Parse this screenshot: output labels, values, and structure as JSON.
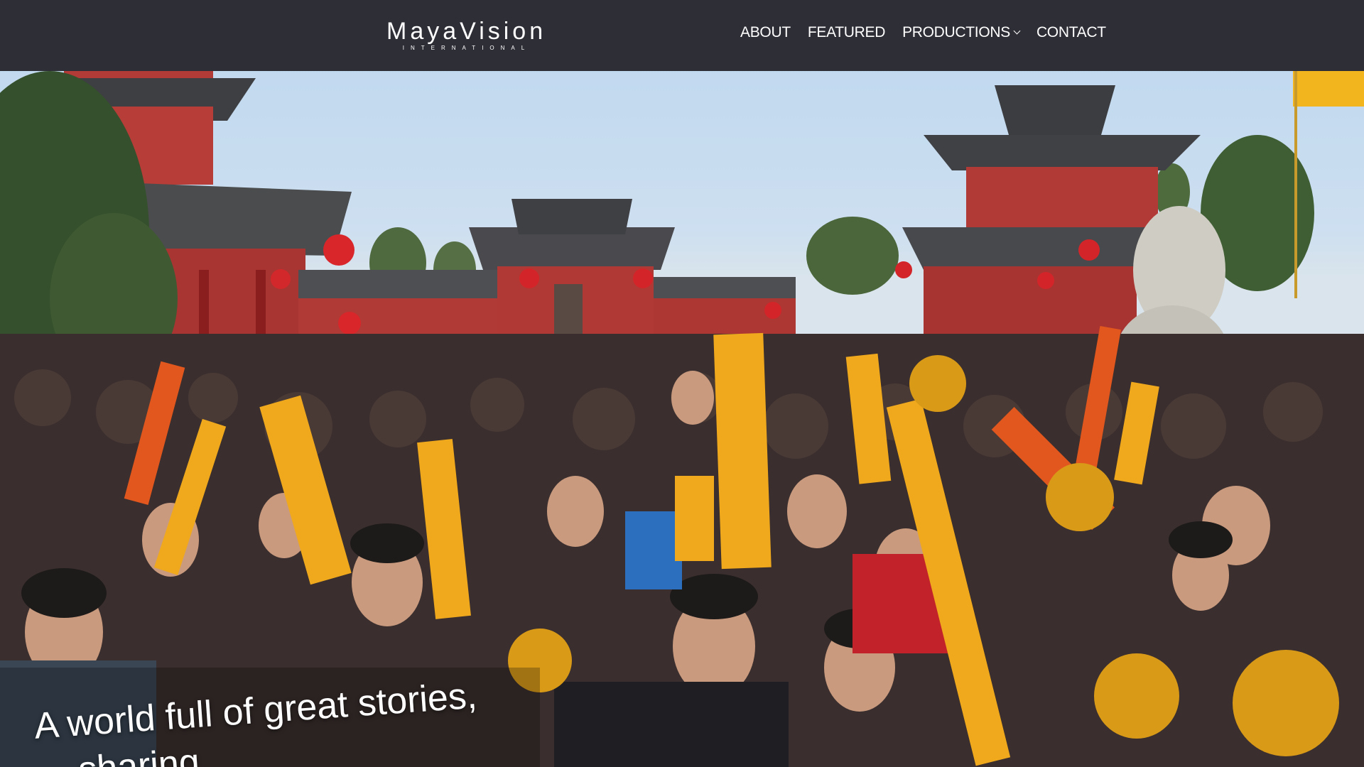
{
  "brand": {
    "name": "MayaVision",
    "sub": "INTERNATIONAL"
  },
  "nav": {
    "items": [
      {
        "label": "ABOUT"
      },
      {
        "label": "FEATURED"
      },
      {
        "label": "PRODUCTIONS",
        "has_dropdown": true,
        "icon": "chevron-down-icon"
      },
      {
        "label": "CONTACT"
      }
    ]
  },
  "hero": {
    "tagline_line1": "A world full of great stories,",
    "tagline_line2": "... sharing"
  },
  "colors": {
    "header_bg": "#2e2e37",
    "text": "#ffffff"
  }
}
